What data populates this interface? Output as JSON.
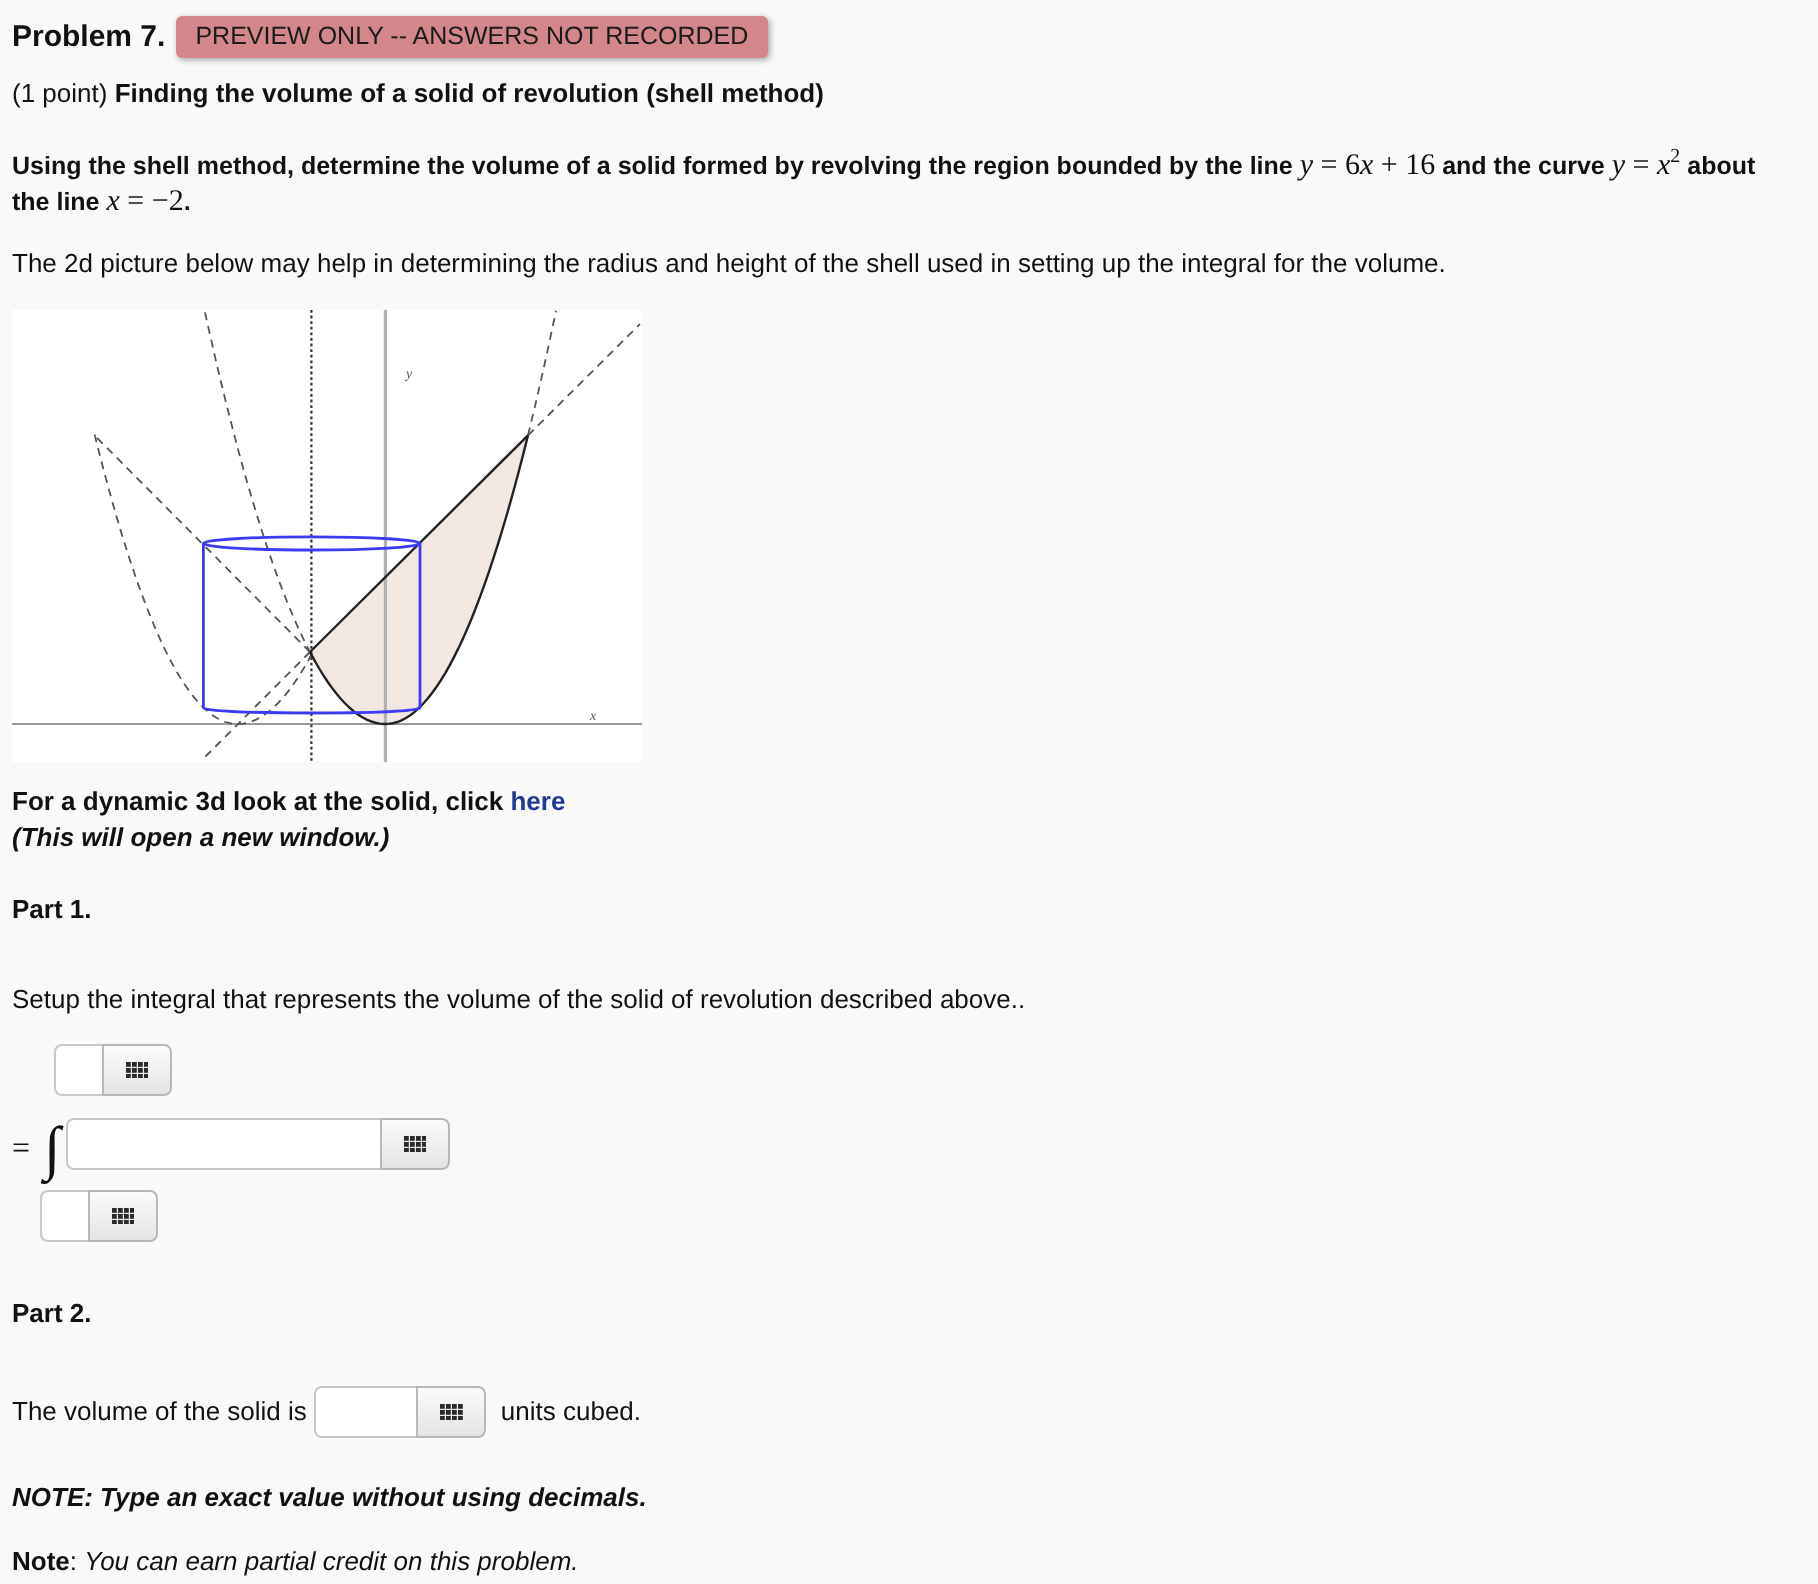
{
  "problem": {
    "title": "Problem 7.",
    "badge": "PREVIEW ONLY -- ANSWERS NOT RECORDED"
  },
  "intro": "(1 point) **Finding the volume of a solid of revolution (shell method)**",
  "statement": [
    {
      "kind": "text",
      "text": "Using the shell method, determine the volume of a solid formed by revolving the region bounded by the line "
    },
    {
      "kind": "math",
      "parts": [
        "*y* = 6",
        "*x*",
        " + 16"
      ]
    },
    {
      "kind": "text",
      "text": " and the curve "
    },
    {
      "kind": "math",
      "parts": [
        "*y* = *x*$^{2}$"
      ]
    },
    {
      "kind": "text",
      "text": " about the line "
    },
    {
      "kind": "math",
      "parts": [
        "*x* = −2"
      ]
    },
    {
      "kind": "text",
      "text": "."
    }
  ],
  "hint": "The 2d picture below may help in determining the radius and height of the shell used in setting up the integral for the volume.",
  "figure": {
    "y_label": "y",
    "x_label": "x"
  },
  "dynamic": {
    "text": "For a dynamic 3d look at the solid, click ",
    "link": "here",
    "note": "(This will open a new window.)"
  },
  "part1": {
    "title": "Part 1.",
    "prompt": "Setup the integral that represents the volume of the solid of revolution described above..",
    "equals": "=",
    "integral_sign": "∫"
  },
  "part2": {
    "title": "Part 2.",
    "before": "The volume of the solid is",
    "after": "units cubed."
  },
  "note_exact": "NOTE: Type an exact value without using decimals.",
  "note": "**Note**: *You can earn partial credit on this problem.*"
}
